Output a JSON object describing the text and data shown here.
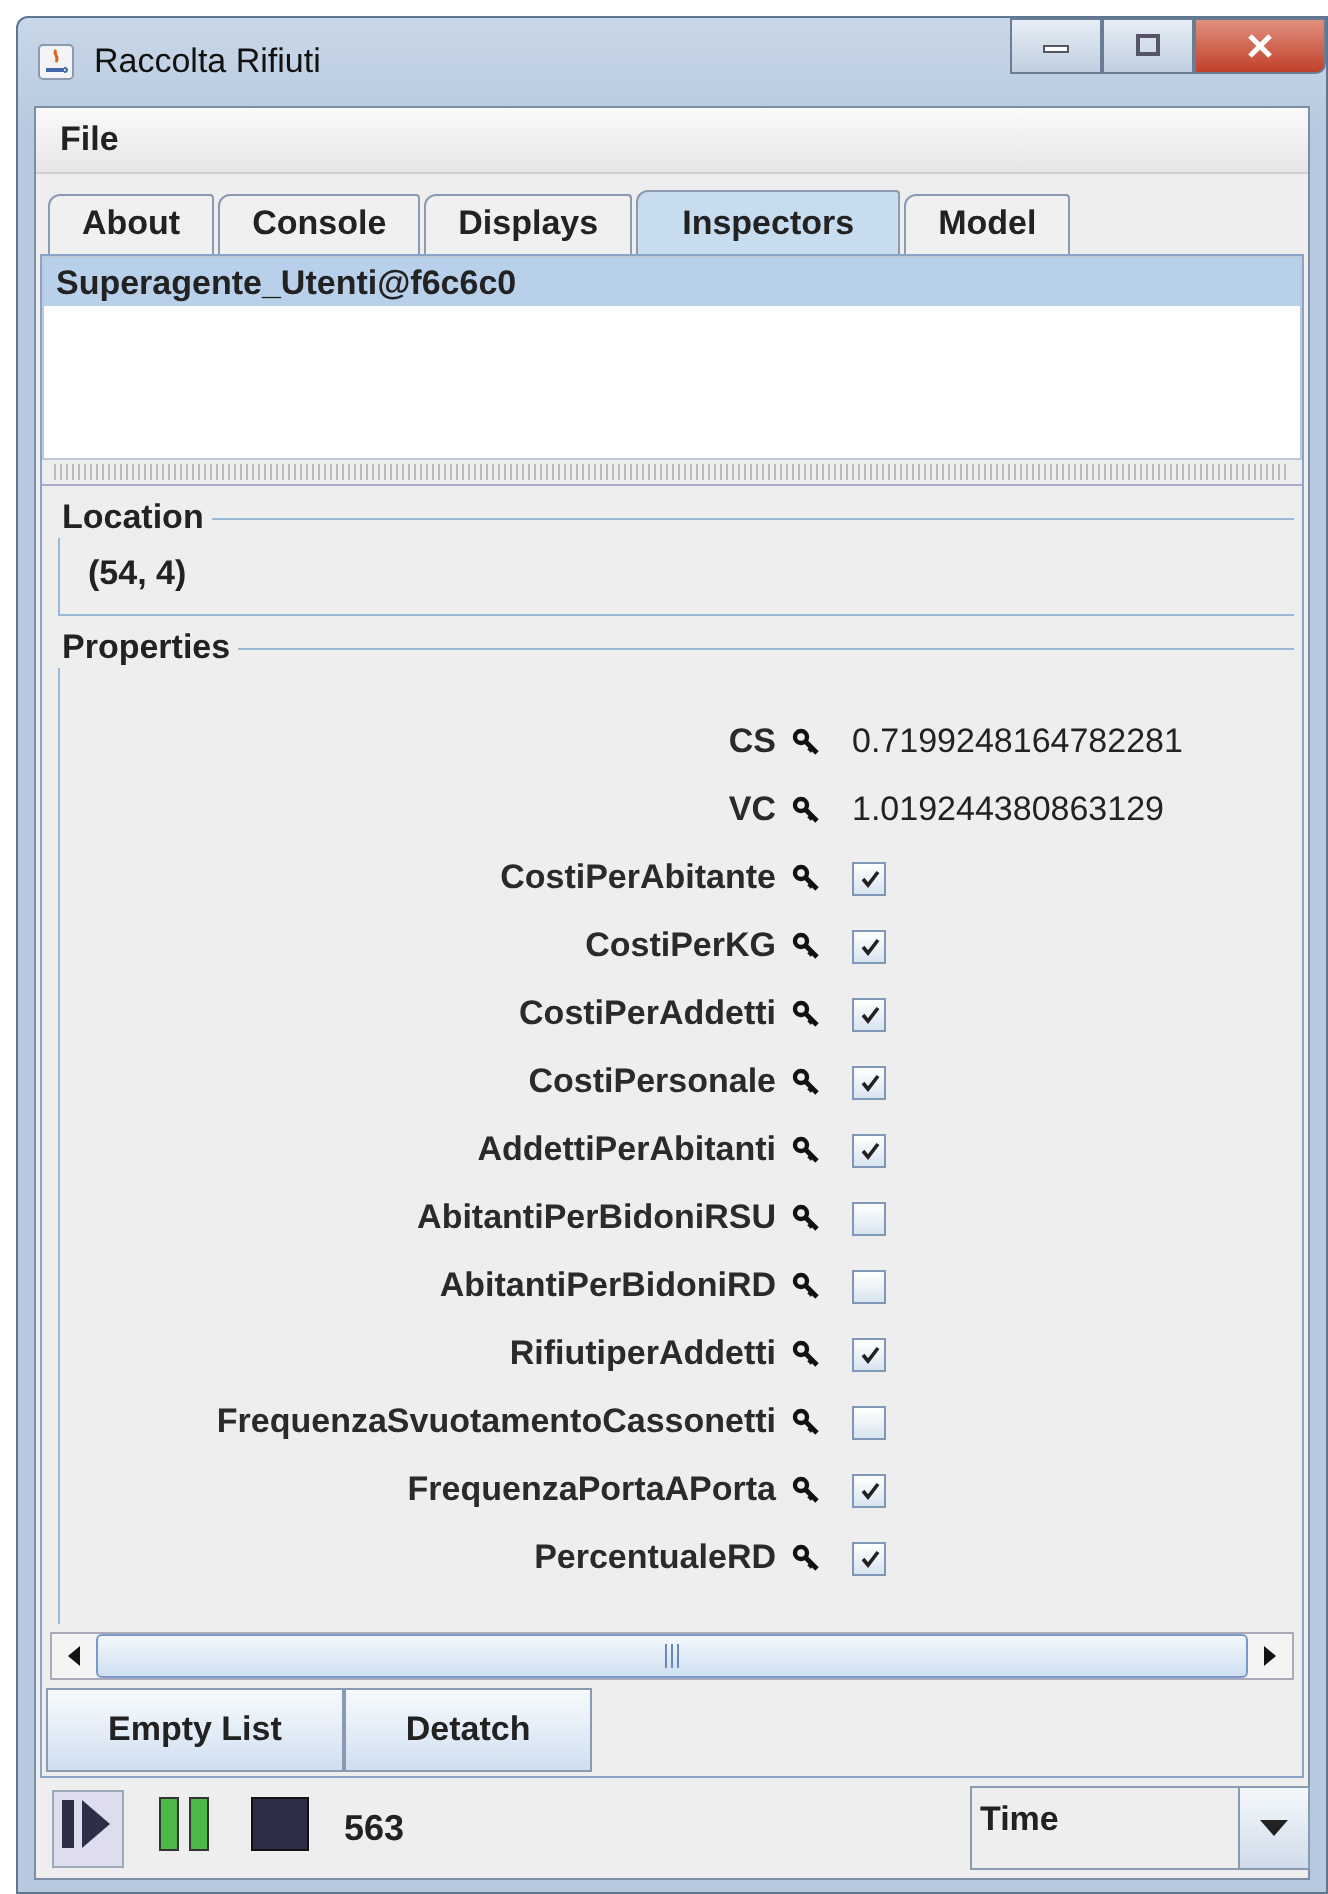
{
  "window": {
    "title": "Raccolta Rifiuti"
  },
  "menu": [
    "File"
  ],
  "tabs": [
    {
      "label": "About",
      "selected": false
    },
    {
      "label": "Console",
      "selected": false
    },
    {
      "label": "Displays",
      "selected": false
    },
    {
      "label": "Inspectors",
      "selected": true
    },
    {
      "label": "Model",
      "selected": false
    }
  ],
  "inspector_list": [
    {
      "label": "Superagente_Utenti@f6c6c0",
      "selected": true
    }
  ],
  "location": {
    "title": "Location",
    "value": "(54, 4)"
  },
  "properties": {
    "title": "Properties",
    "rows": [
      {
        "kind": "text",
        "name": "CS",
        "value": "0.7199248164782281"
      },
      {
        "kind": "text",
        "name": "VC",
        "value": "1.019244380863129"
      },
      {
        "kind": "checkbox",
        "name": "CostiPerAbitante",
        "checked": true
      },
      {
        "kind": "checkbox",
        "name": "CostiPerKG",
        "checked": true
      },
      {
        "kind": "checkbox",
        "name": "CostiPerAddetti",
        "checked": true
      },
      {
        "kind": "checkbox",
        "name": "CostiPersonale",
        "checked": true
      },
      {
        "kind": "checkbox",
        "name": "AddettiPerAbitanti",
        "checked": true
      },
      {
        "kind": "checkbox",
        "name": "AbitantiPerBidoniRSU",
        "checked": false
      },
      {
        "kind": "checkbox",
        "name": "AbitantiPerBidoniRD",
        "checked": false
      },
      {
        "kind": "checkbox",
        "name": "RifiutiperAddetti",
        "checked": true
      },
      {
        "kind": "checkbox",
        "name": "FrequenzaSvuotamentoCassonetti",
        "checked": false
      },
      {
        "kind": "checkbox",
        "name": "FrequenzaPortaAPorta",
        "checked": true
      },
      {
        "kind": "checkbox",
        "name": "PercentualeRD",
        "checked": true
      }
    ]
  },
  "buttons": [
    "Empty List",
    "Detatch"
  ],
  "status_bar": {
    "steps": "563",
    "time_mode": "Time"
  }
}
